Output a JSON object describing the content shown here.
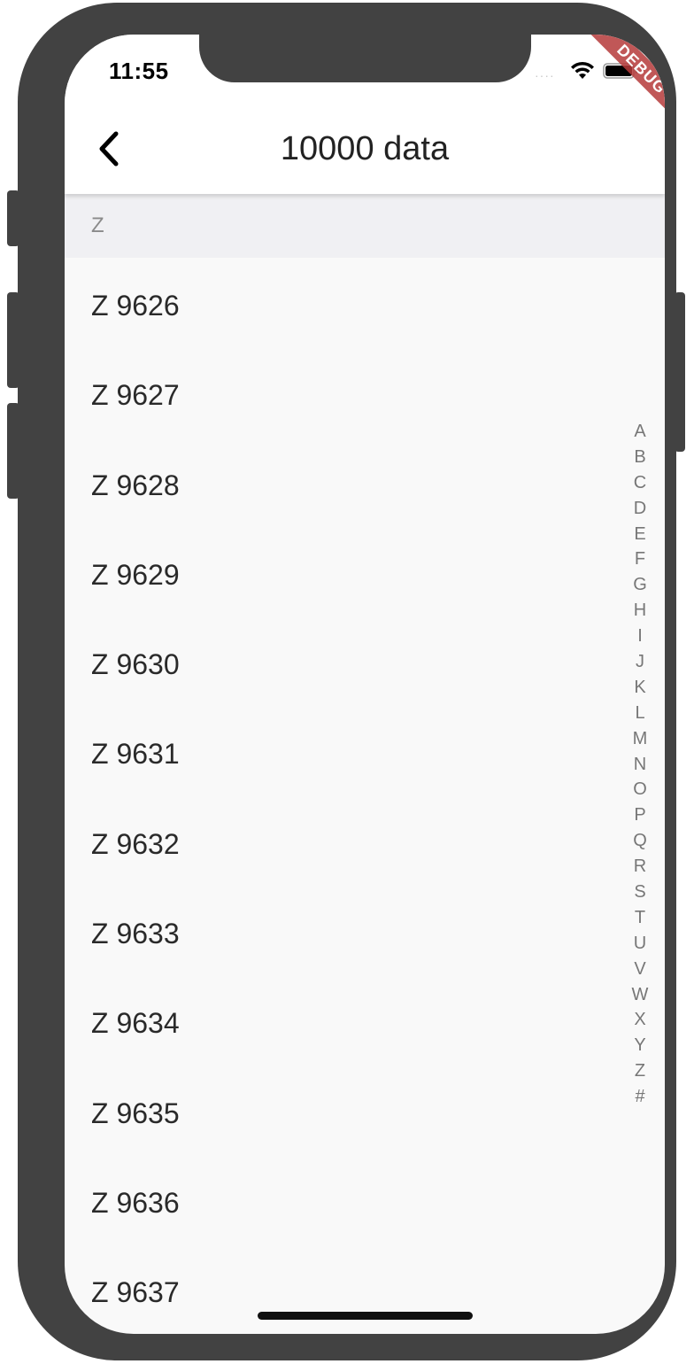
{
  "status_bar": {
    "time": "11:55",
    "signal": "····"
  },
  "debug_banner": "DEBUG",
  "app_bar": {
    "title": "10000 data",
    "back_icon": "chevron-left-icon"
  },
  "section": {
    "header": "Z"
  },
  "items": [
    "Z 9626",
    "Z 9627",
    "Z 9628",
    "Z 9629",
    "Z 9630",
    "Z 9631",
    "Z 9632",
    "Z 9633",
    "Z 9634",
    "Z 9635",
    "Z 9636",
    "Z 9637"
  ],
  "index_letters": [
    "A",
    "B",
    "C",
    "D",
    "E",
    "F",
    "G",
    "H",
    "I",
    "J",
    "K",
    "L",
    "M",
    "N",
    "O",
    "P",
    "Q",
    "R",
    "S",
    "T",
    "U",
    "V",
    "W",
    "X",
    "Y",
    "Z",
    "#"
  ],
  "colors": {
    "device_frame": "#424242",
    "background": "#f9f9f9",
    "section_header_bg": "#f0f0f3",
    "debug_banner": "#b53a3a"
  }
}
